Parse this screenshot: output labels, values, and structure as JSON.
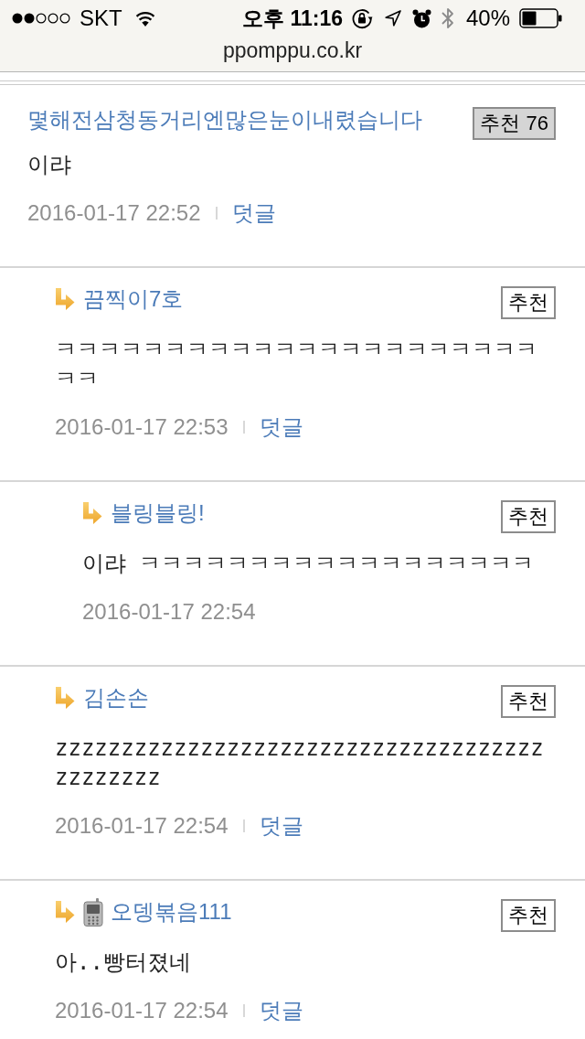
{
  "status_bar": {
    "carrier": "SKT",
    "time": "오후 11:16",
    "battery": "40%"
  },
  "address_bar": {
    "url": "ppomppu.co.kr"
  },
  "comments": [
    {
      "author": "몇해전삼청동거리엔많은눈이내렸습니다",
      "mobile": false,
      "recommend": {
        "label": "추천",
        "count": "76"
      },
      "text": "이랴",
      "date": "2016-01-17 22:52",
      "reply_link": "덧글",
      "children": [
        {
          "author": "끔찍이7호",
          "mobile": false,
          "recommend": {
            "label": "추천"
          },
          "text": "ㅋㅋㅋㅋㅋㅋㅋㅋㅋㅋㅋㅋㅋㅋㅋㅋㅋㅋㅋㅋㅋㅋㅋㅋ",
          "date": "2016-01-17 22:53",
          "reply_link": "덧글",
          "children": [
            {
              "author": "블링블링!",
              "mobile": false,
              "recommend": {
                "label": "추천"
              },
              "text": "이랴 ㅋㅋㅋㅋㅋㅋㅋㅋㅋㅋㅋㅋㅋㅋㅋㅋㅋㅋ",
              "date": "2016-01-17 22:54"
            }
          ]
        },
        {
          "author": "김손손",
          "mobile": false,
          "recommend": {
            "label": "추천"
          },
          "text": "zzzzzzzzzzzzzzzzzzzzzzzzzzzzzzzzzzzzzzzzzzzzz",
          "date": "2016-01-17 22:54",
          "reply_link": "덧글"
        },
        {
          "author": "오뎅볶음111",
          "mobile": true,
          "recommend": {
            "label": "추천"
          },
          "text": "아..빵터졌네",
          "date": "2016-01-17 22:54",
          "reply_link": "덧글"
        }
      ]
    }
  ]
}
